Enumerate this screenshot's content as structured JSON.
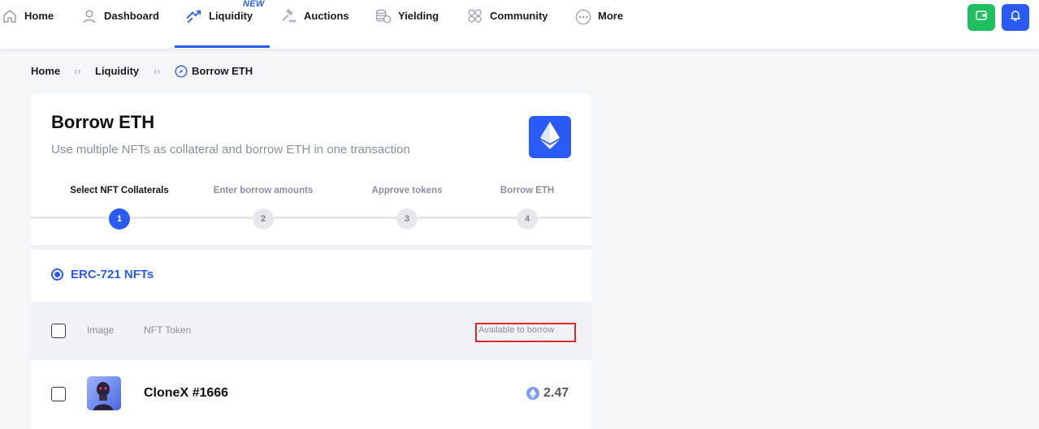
{
  "nav": {
    "items": [
      {
        "label": "Home",
        "icon": "home-icon"
      },
      {
        "label": "Dashboard",
        "icon": "user-icon"
      },
      {
        "label": "Liquidity",
        "icon": "swap-arrows-icon",
        "badge": "NEW",
        "active": true
      },
      {
        "label": "Auctions",
        "icon": "gavel-icon"
      },
      {
        "label": "Yielding",
        "icon": "coins-icon"
      },
      {
        "label": "Community",
        "icon": "community-icon"
      },
      {
        "label": "More",
        "icon": "more-dots-icon"
      }
    ],
    "wallet_icon": "wallet-icon",
    "notification_icon": "bell-icon"
  },
  "breadcrumb": {
    "items": [
      "Home",
      "Liquidity",
      "Borrow ETH"
    ],
    "separator": "››"
  },
  "card": {
    "title": "Borrow ETH",
    "subtitle": "Use multiple NFTs as collateral and borrow ETH in one transaction",
    "steps": [
      {
        "label": "Select NFT Collaterals",
        "number": "1",
        "current": true
      },
      {
        "label": "Enter borrow amounts",
        "number": "2",
        "current": false
      },
      {
        "label": "Approve tokens",
        "number": "3",
        "current": false
      },
      {
        "label": "Borrow ETH",
        "number": "4",
        "current": false
      }
    ],
    "token_type": "ERC-721 NFTs",
    "table": {
      "headers": {
        "image": "Image",
        "token": "NFT Token",
        "available": "Available to borrow"
      },
      "rows": [
        {
          "name": "CloneX #1666",
          "amount": "2.47"
        }
      ]
    }
  },
  "colors": {
    "accent": "#2a5bf5",
    "wallet_button": "#1fbf5f",
    "highlight_box": "#e0262a"
  }
}
